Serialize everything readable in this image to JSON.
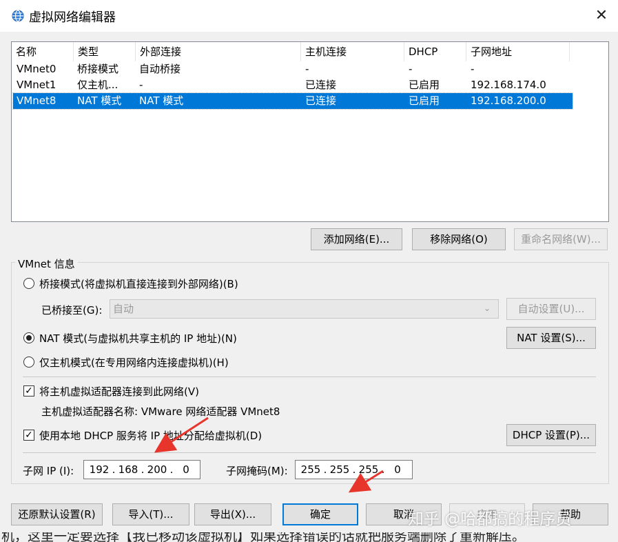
{
  "window": {
    "title": "虚拟网络编辑器",
    "close_glyph": "✕"
  },
  "network_list": {
    "columns": [
      "名称",
      "类型",
      "外部连接",
      "主机连接",
      "DHCP",
      "子网地址"
    ],
    "rows": [
      {
        "name": "VMnet0",
        "type": "桥接模式",
        "external": "自动桥接",
        "host": "-",
        "dhcp": "-",
        "subnet": "-",
        "selected": false
      },
      {
        "name": "VMnet1",
        "type": "仅主机...",
        "external": "-",
        "host": "已连接",
        "dhcp": "已启用",
        "subnet": "192.168.174.0",
        "selected": false
      },
      {
        "name": "VMnet8",
        "type": "NAT 模式",
        "external": "NAT 模式",
        "host": "已连接",
        "dhcp": "已启用",
        "subnet": "192.168.200.0",
        "selected": true
      }
    ]
  },
  "list_buttons": {
    "add": "添加网络(E)...",
    "remove": "移除网络(O)",
    "rename": "重命名网络(W)..."
  },
  "vmnet_info": {
    "group_label": "VMnet 信息",
    "bridge_radio": "桥接模式(将虚拟机直接连接到外部网络)(B)",
    "bridged_to_label": "已桥接至(G):",
    "bridged_to_value": "自动",
    "auto_settings": "自动设置(U)...",
    "nat_radio": "NAT 模式(与虚拟机共享主机的 IP 地址)(N)",
    "nat_settings": "NAT 设置(S)...",
    "hostonly_radio": "仅主机模式(在专用网络内连接虚拟机)(H)",
    "selected_mode": "nat",
    "connect_adapter_check": "将主机虚拟适配器连接到此网络(V)",
    "connect_adapter_checked": true,
    "adapter_name": "主机虚拟适配器名称: VMware 网络适配器 VMnet8",
    "dhcp_check": "使用本地 DHCP 服务将 IP 地址分配给虚拟机(D)",
    "dhcp_checked": true,
    "dhcp_settings": "DHCP 设置(P)...",
    "subnet_ip_label": "子网 IP (I):",
    "subnet_ip": [
      "192",
      "168",
      "200",
      "0"
    ],
    "subnet_mask_label": "子网掩码(M):",
    "subnet_mask": [
      "255",
      "255",
      "255",
      "0"
    ]
  },
  "footer_buttons": {
    "restore": "还原默认设置(R)",
    "import": "导入(T)...",
    "export": "导出(X)...",
    "ok": "确定",
    "cancel": "取消",
    "apply": "应用",
    "help": "帮助"
  },
  "watermark": "知乎 @哈都搞的程序员",
  "bottom_text": "机，这里一定要选择【我已移动该虚拟机】如果选择错误的话就把服务端删除了重新解压。",
  "colors": {
    "selection": "#0078d7",
    "annotation_arrow": "#e8352b"
  }
}
